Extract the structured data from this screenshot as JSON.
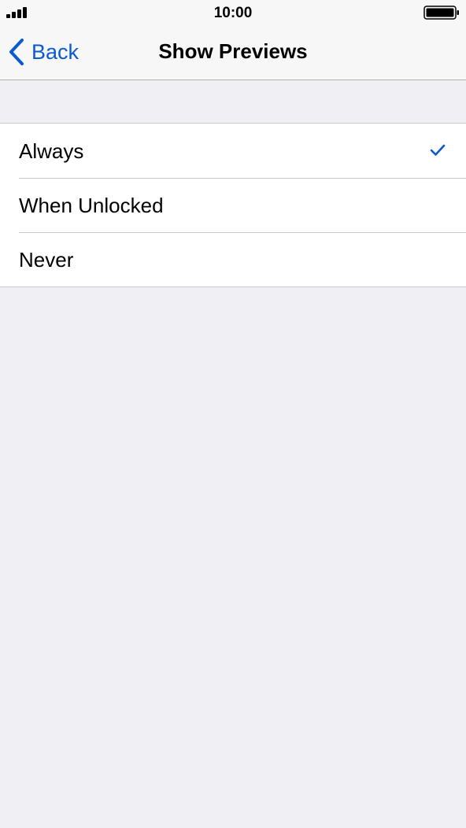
{
  "status_bar": {
    "time": "10:00",
    "signal_icon": "cellular-signal-icon",
    "battery_icon": "battery-full-icon"
  },
  "nav": {
    "back_label": "Back",
    "back_icon": "chevron-left-icon",
    "title": "Show Previews"
  },
  "options": [
    {
      "label": "Always",
      "selected": true
    },
    {
      "label": "When Unlocked",
      "selected": false
    },
    {
      "label": "Never",
      "selected": false
    }
  ],
  "colors": {
    "accent": "#0a5ad4",
    "background": "#efeff4",
    "bar_background": "#f7f7f7",
    "separator": "#c8c7cc"
  }
}
